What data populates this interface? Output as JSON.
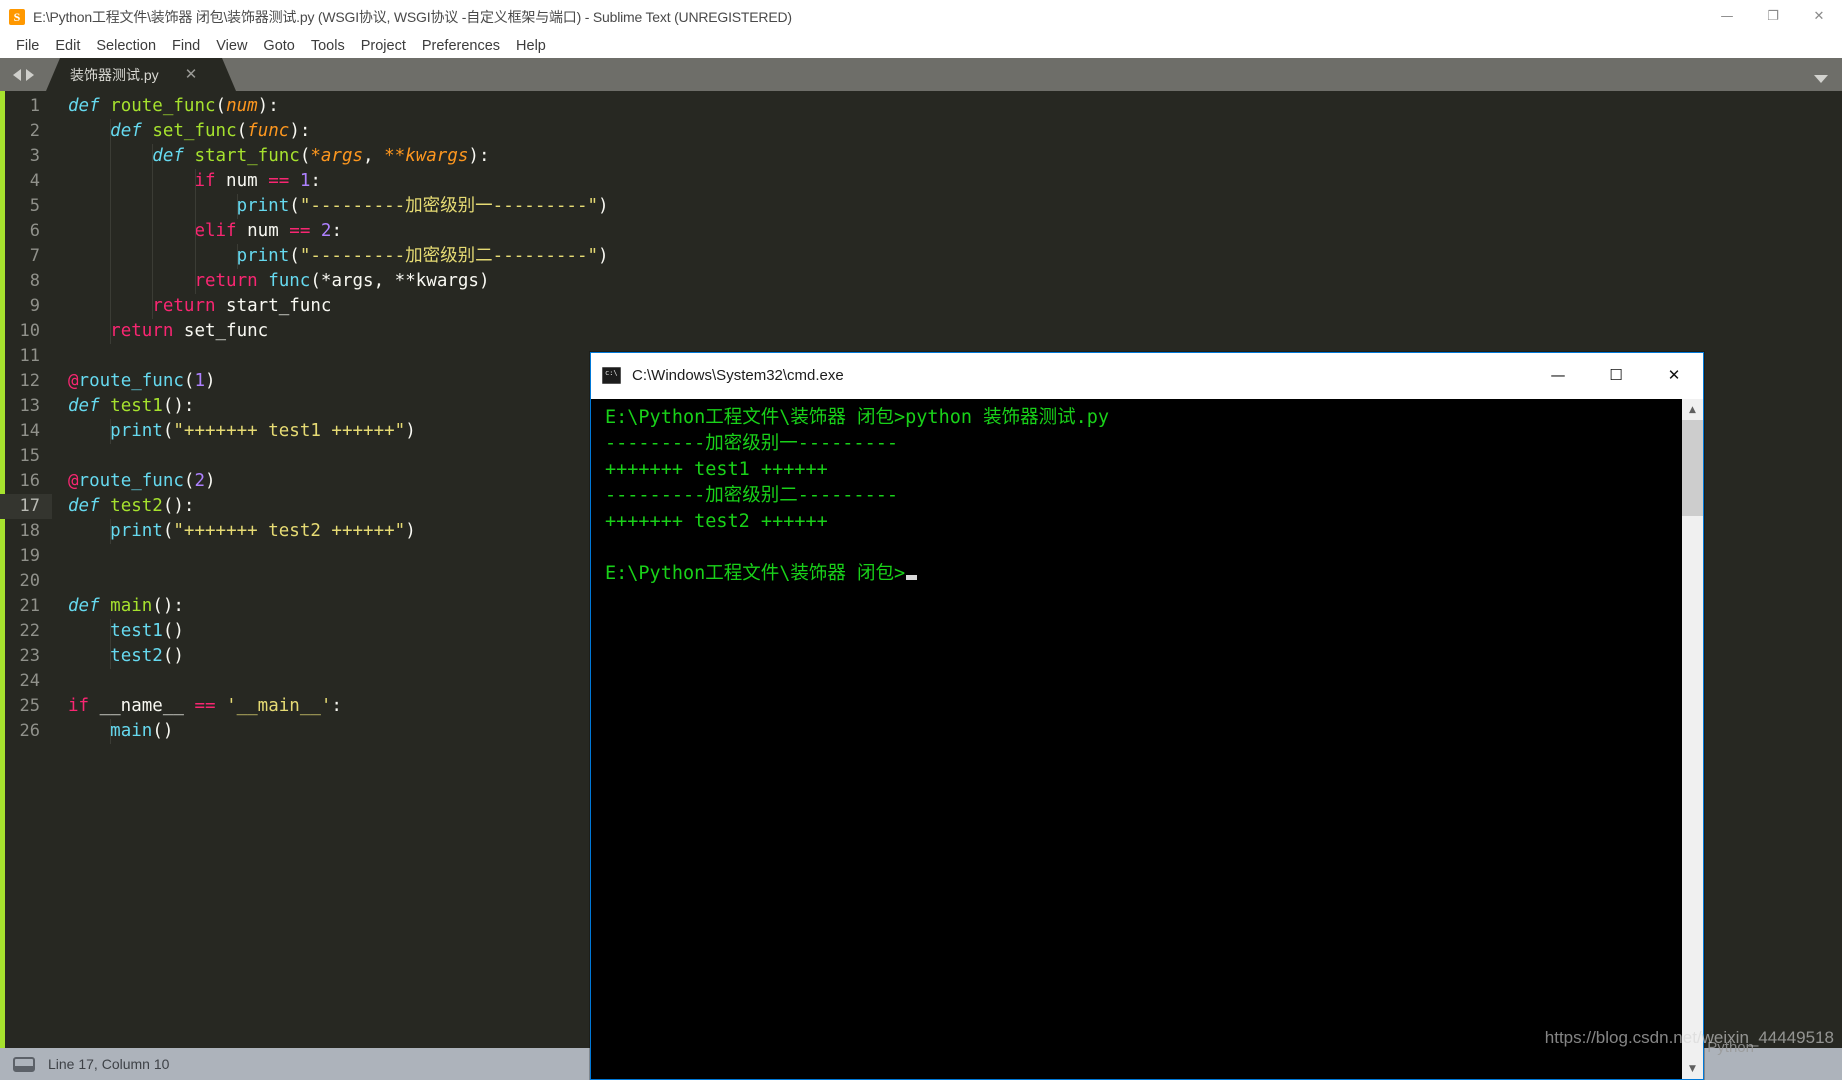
{
  "sublime": {
    "title": "E:\\Python工程文件\\装饰器 闭包\\装饰器测试.py (WSGI协议, WSGI协议 -自定义框架与端口) - Sublime Text (UNREGISTERED)",
    "app_icon": "sublime-icon",
    "window_controls": {
      "minimize": "—",
      "maximize": "❐",
      "close": "✕"
    },
    "menu": [
      "File",
      "Edit",
      "Selection",
      "Find",
      "View",
      "Goto",
      "Tools",
      "Project",
      "Preferences",
      "Help"
    ],
    "tab": {
      "label": "装饰器测试.py",
      "close": "✕"
    },
    "status": {
      "text": "Line 17, Column 10",
      "icon": "panel-icon"
    },
    "watermark": "https://blog.csdn.net/weixin_44449518",
    "python_watermark": "Python",
    "colors": {
      "background": "#272822",
      "accent_green": "#a6e22e",
      "keyword_pink": "#f92672",
      "def_cyan": "#66d9ef",
      "func_green": "#a6e22e",
      "param_orange": "#fd971f",
      "number_purple": "#ae81ff",
      "string_yellow": "#e6db74",
      "plain_white": "#f8f8f2",
      "gutter_grey": "#90918b",
      "statusbar": "#adb3bb",
      "tabbar": "#6e6e69"
    },
    "code": [
      {
        "n": "1",
        "indent": 0,
        "active": false,
        "tokens": [
          {
            "t": "def",
            "c": "t-def"
          },
          {
            "t": " ",
            "c": "t-plain"
          },
          {
            "t": "route_func",
            "c": "t-fn"
          },
          {
            "t": "(",
            "c": "t-punct"
          },
          {
            "t": "num",
            "c": "t-param"
          },
          {
            "t": ")",
            "c": "t-punct"
          },
          {
            "t": ":",
            "c": "t-plain"
          }
        ]
      },
      {
        "n": "2",
        "indent": 1,
        "active": false,
        "tokens": [
          {
            "t": "    ",
            "c": "t-plain"
          },
          {
            "t": "def",
            "c": "t-def"
          },
          {
            "t": " ",
            "c": "t-plain"
          },
          {
            "t": "set_func",
            "c": "t-fn"
          },
          {
            "t": "(",
            "c": "t-punct"
          },
          {
            "t": "func",
            "c": "t-param"
          },
          {
            "t": ")",
            "c": "t-punct"
          },
          {
            "t": ":",
            "c": "t-plain"
          }
        ]
      },
      {
        "n": "3",
        "indent": 2,
        "active": false,
        "tokens": [
          {
            "t": "        ",
            "c": "t-plain"
          },
          {
            "t": "def",
            "c": "t-def"
          },
          {
            "t": " ",
            "c": "t-plain"
          },
          {
            "t": "start_func",
            "c": "t-fn"
          },
          {
            "t": "(",
            "c": "t-punct"
          },
          {
            "t": "*args",
            "c": "t-param"
          },
          {
            "t": ", ",
            "c": "t-plain"
          },
          {
            "t": "**kwargs",
            "c": "t-param"
          },
          {
            "t": ")",
            "c": "t-punct"
          },
          {
            "t": ":",
            "c": "t-plain"
          }
        ]
      },
      {
        "n": "4",
        "indent": 3,
        "active": false,
        "tokens": [
          {
            "t": "            ",
            "c": "t-plain"
          },
          {
            "t": "if",
            "c": "t-kw"
          },
          {
            "t": " num ",
            "c": "t-plain"
          },
          {
            "t": "==",
            "c": "t-kw"
          },
          {
            "t": " ",
            "c": "t-plain"
          },
          {
            "t": "1",
            "c": "t-num"
          },
          {
            "t": ":",
            "c": "t-plain"
          }
        ]
      },
      {
        "n": "5",
        "indent": 4,
        "active": false,
        "tokens": [
          {
            "t": "                ",
            "c": "t-plain"
          },
          {
            "t": "print",
            "c": "t-call"
          },
          {
            "t": "(",
            "c": "t-punct"
          },
          {
            "t": "\"---------加密级别一---------\"",
            "c": "t-str"
          },
          {
            "t": ")",
            "c": "t-punct"
          }
        ]
      },
      {
        "n": "6",
        "indent": 3,
        "active": false,
        "tokens": [
          {
            "t": "            ",
            "c": "t-plain"
          },
          {
            "t": "elif",
            "c": "t-kw"
          },
          {
            "t": " num ",
            "c": "t-plain"
          },
          {
            "t": "==",
            "c": "t-kw"
          },
          {
            "t": " ",
            "c": "t-plain"
          },
          {
            "t": "2",
            "c": "t-num"
          },
          {
            "t": ":",
            "c": "t-plain"
          }
        ]
      },
      {
        "n": "7",
        "indent": 4,
        "active": false,
        "tokens": [
          {
            "t": "                ",
            "c": "t-plain"
          },
          {
            "t": "print",
            "c": "t-call"
          },
          {
            "t": "(",
            "c": "t-punct"
          },
          {
            "t": "\"---------加密级别二---------\"",
            "c": "t-str"
          },
          {
            "t": ")",
            "c": "t-punct"
          }
        ]
      },
      {
        "n": "8",
        "indent": 3,
        "active": false,
        "tokens": [
          {
            "t": "            ",
            "c": "t-plain"
          },
          {
            "t": "return",
            "c": "t-kw"
          },
          {
            "t": " ",
            "c": "t-plain"
          },
          {
            "t": "func",
            "c": "t-call"
          },
          {
            "t": "(",
            "c": "t-punct"
          },
          {
            "t": "*args",
            "c": "t-plain"
          },
          {
            "t": ", ",
            "c": "t-plain"
          },
          {
            "t": "**kwargs",
            "c": "t-plain"
          },
          {
            "t": ")",
            "c": "t-punct"
          }
        ]
      },
      {
        "n": "9",
        "indent": 2,
        "active": false,
        "tokens": [
          {
            "t": "        ",
            "c": "t-plain"
          },
          {
            "t": "return",
            "c": "t-kw"
          },
          {
            "t": " start_func",
            "c": "t-plain"
          }
        ]
      },
      {
        "n": "10",
        "indent": 1,
        "active": false,
        "tokens": [
          {
            "t": "    ",
            "c": "t-plain"
          },
          {
            "t": "return",
            "c": "t-kw"
          },
          {
            "t": " set_func",
            "c": "t-plain"
          }
        ]
      },
      {
        "n": "11",
        "indent": 0,
        "active": false,
        "tokens": []
      },
      {
        "n": "12",
        "indent": 0,
        "active": false,
        "tokens": [
          {
            "t": "@",
            "c": "t-kw"
          },
          {
            "t": "route_func",
            "c": "t-call"
          },
          {
            "t": "(",
            "c": "t-punct"
          },
          {
            "t": "1",
            "c": "t-num"
          },
          {
            "t": ")",
            "c": "t-punct"
          }
        ]
      },
      {
        "n": "13",
        "indent": 0,
        "active": false,
        "tokens": [
          {
            "t": "def",
            "c": "t-def"
          },
          {
            "t": " ",
            "c": "t-plain"
          },
          {
            "t": "test1",
            "c": "t-fn"
          },
          {
            "t": "()",
            "c": "t-punct"
          },
          {
            "t": ":",
            "c": "t-plain"
          }
        ]
      },
      {
        "n": "14",
        "indent": 1,
        "active": false,
        "tokens": [
          {
            "t": "    ",
            "c": "t-plain"
          },
          {
            "t": "print",
            "c": "t-call"
          },
          {
            "t": "(",
            "c": "t-punct"
          },
          {
            "t": "\"+++++++ test1 ++++++\"",
            "c": "t-str"
          },
          {
            "t": ")",
            "c": "t-punct"
          }
        ]
      },
      {
        "n": "15",
        "indent": 0,
        "active": false,
        "tokens": []
      },
      {
        "n": "16",
        "indent": 0,
        "active": false,
        "tokens": [
          {
            "t": "@",
            "c": "t-kw"
          },
          {
            "t": "route_func",
            "c": "t-call"
          },
          {
            "t": "(",
            "c": "t-punct"
          },
          {
            "t": "2",
            "c": "t-num"
          },
          {
            "t": ")",
            "c": "t-punct"
          }
        ]
      },
      {
        "n": "17",
        "indent": 0,
        "active": true,
        "tokens": [
          {
            "t": "def",
            "c": "t-def"
          },
          {
            "t": " ",
            "c": "t-plain"
          },
          {
            "t": "test2",
            "c": "t-fn"
          },
          {
            "t": "()",
            "c": "t-punct"
          },
          {
            "t": ":",
            "c": "t-plain"
          }
        ]
      },
      {
        "n": "18",
        "indent": 1,
        "active": false,
        "tokens": [
          {
            "t": "    ",
            "c": "t-plain"
          },
          {
            "t": "print",
            "c": "t-call"
          },
          {
            "t": "(",
            "c": "t-punct"
          },
          {
            "t": "\"+++++++ test2 ++++++\"",
            "c": "t-str"
          },
          {
            "t": ")",
            "c": "t-punct"
          }
        ]
      },
      {
        "n": "19",
        "indent": 0,
        "active": false,
        "tokens": []
      },
      {
        "n": "20",
        "indent": 0,
        "active": false,
        "tokens": []
      },
      {
        "n": "21",
        "indent": 0,
        "active": false,
        "tokens": [
          {
            "t": "def",
            "c": "t-def"
          },
          {
            "t": " ",
            "c": "t-plain"
          },
          {
            "t": "main",
            "c": "t-fn"
          },
          {
            "t": "()",
            "c": "t-punct"
          },
          {
            "t": ":",
            "c": "t-plain"
          }
        ]
      },
      {
        "n": "22",
        "indent": 1,
        "active": false,
        "tokens": [
          {
            "t": "    ",
            "c": "t-plain"
          },
          {
            "t": "test1",
            "c": "t-call"
          },
          {
            "t": "()",
            "c": "t-punct"
          }
        ]
      },
      {
        "n": "23",
        "indent": 1,
        "active": false,
        "tokens": [
          {
            "t": "    ",
            "c": "t-plain"
          },
          {
            "t": "test2",
            "c": "t-call"
          },
          {
            "t": "()",
            "c": "t-punct"
          }
        ]
      },
      {
        "n": "24",
        "indent": 0,
        "active": false,
        "tokens": []
      },
      {
        "n": "25",
        "indent": 0,
        "active": false,
        "tokens": [
          {
            "t": "if",
            "c": "t-kw"
          },
          {
            "t": " __name__ ",
            "c": "t-plain"
          },
          {
            "t": "==",
            "c": "t-kw"
          },
          {
            "t": " ",
            "c": "t-plain"
          },
          {
            "t": "'__main__'",
            "c": "t-str"
          },
          {
            "t": ":",
            "c": "t-plain"
          }
        ]
      },
      {
        "n": "26",
        "indent": 1,
        "active": false,
        "tokens": [
          {
            "t": "    ",
            "c": "t-plain"
          },
          {
            "t": "main",
            "c": "t-call"
          },
          {
            "t": "()",
            "c": "t-punct"
          }
        ]
      }
    ]
  },
  "cmd": {
    "title": "C:\\Windows\\System32\\cmd.exe",
    "icon": "cmd-icon",
    "window_controls": {
      "minimize": "—",
      "maximize": "☐",
      "close": "✕"
    },
    "text_color": "#19d119",
    "background": "#000000",
    "lines": [
      "E:\\Python工程文件\\装饰器 闭包>python 装饰器测试.py",
      "---------加密级别一---------",
      "+++++++ test1 ++++++",
      "---------加密级别二---------",
      "+++++++ test2 ++++++",
      "",
      "E:\\Python工程文件\\装饰器 闭包>"
    ],
    "scrollbar": {
      "up_arrow": "▲",
      "down_arrow": "▼"
    }
  }
}
